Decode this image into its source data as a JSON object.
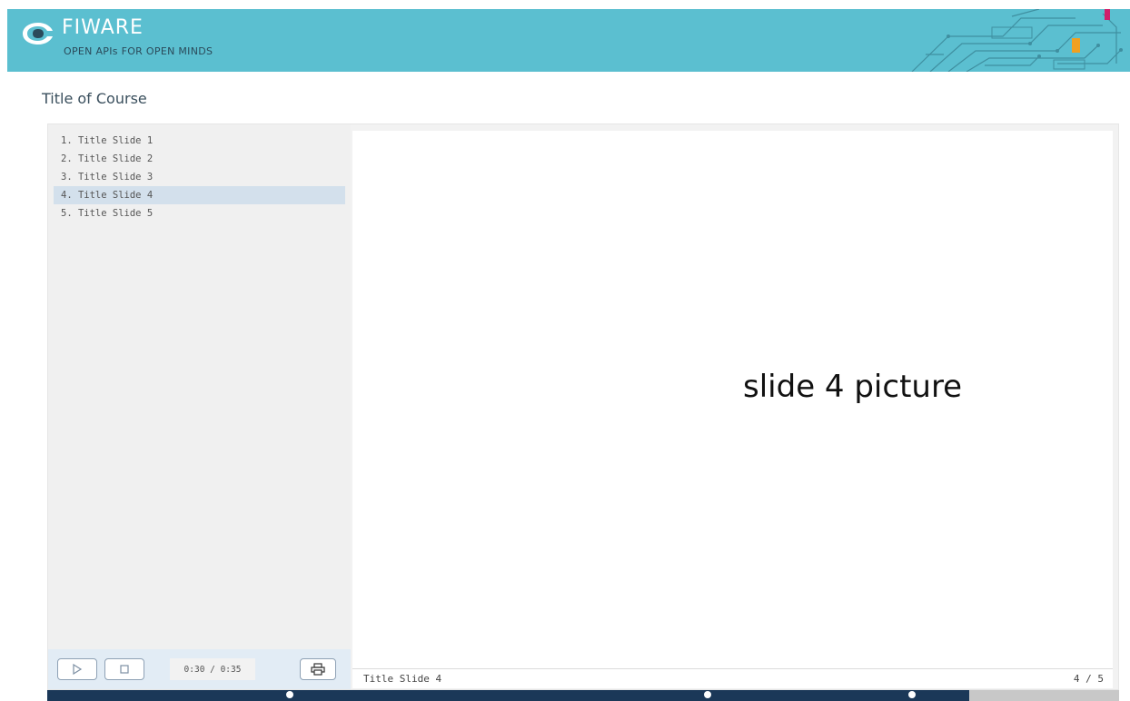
{
  "header": {
    "brand": "FIWARE",
    "tagline": "OPEN APIs FOR OPEN MINDS",
    "background_color": "#5bbfd0"
  },
  "course": {
    "title": "Title of Course"
  },
  "slides": [
    {
      "label": "1. Title Slide 1"
    },
    {
      "label": "2. Title Slide 2"
    },
    {
      "label": "3. Title Slide 3"
    },
    {
      "label": "4. Title Slide 4",
      "active": true
    },
    {
      "label": "5. Title Slide 5"
    }
  ],
  "current_slide": {
    "picture_text": "slide 4  picture",
    "title": "Title Slide 4",
    "page_indicator": "4 / 5"
  },
  "controls": {
    "play_icon": "play-icon",
    "stop_icon": "stop-icon",
    "print_icon": "print-icon",
    "time": "0:30 / 0:35"
  },
  "progress": {
    "fraction": 0.86,
    "fill_color": "#1b3858",
    "marker_fractions": [
      0.226,
      0.616,
      0.807
    ]
  }
}
